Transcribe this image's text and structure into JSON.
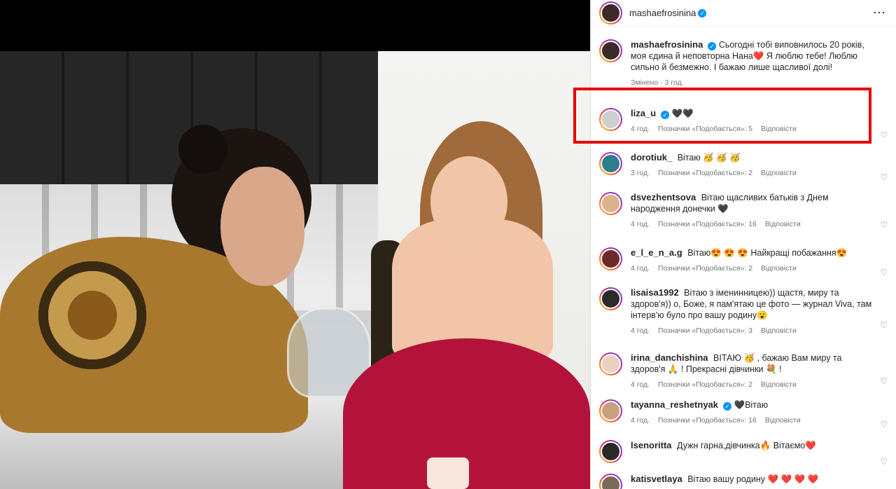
{
  "post": {
    "author": "mashaefrosinina",
    "more_icon": "⋯"
  },
  "caption": {
    "username": "mashaefrosinina",
    "text": "Сьогодні тобі виповнилось 20 років, моя єдина й неповторна Нана❤️  Я люблю тебе! Люблю сильно й безмежно. І бажаю лише щасливої долі!",
    "meta": "Змінено · 3 год."
  },
  "comments": [
    {
      "username": "liza_u",
      "verified": true,
      "text": "🖤🖤",
      "time": "4 год.",
      "likes": "Позначки «Подобається»: 5",
      "reply": "Відповісти"
    },
    {
      "username": "dorotiuk_",
      "verified": false,
      "text": "Вітаю 🥳 🥳 🥳",
      "time": "3 год.",
      "likes": "Позначки «Подобається»: 2",
      "reply": "Відповісти"
    },
    {
      "username": "dsvezhentsova",
      "verified": false,
      "text": "Вітаю щасливих батьків з Днем народження донечки 🖤",
      "time": "4 год.",
      "likes": "Позначки «Подобається»: 16",
      "reply": "Відповісти"
    },
    {
      "username": "e_l_e_n_a.g",
      "verified": false,
      "text": "Вітаю😍 😍 😍 Найкращі побажання😍",
      "time": "4 год.",
      "likes": "Позначки «Подобається»: 2",
      "reply": "Відповісти"
    },
    {
      "username": "lisaisa1992",
      "verified": false,
      "text": "Вітаю з іменинницею)) щастя, миру та здоров'я)) о, Боже, я пам'ятаю це фото — журнал Viva, там інтерв'ю було про вашу родину😮",
      "time": "4 год.",
      "likes": "Позначки «Подобається»: 3",
      "reply": "Відповісти"
    },
    {
      "username": "irina_danchishina",
      "verified": false,
      "text": "ВІТАЮ 🥳 , бажаю Вам миру та здоров'я 🙏 ! Прекрасні дівчинки 💐 !",
      "time": "4 год.",
      "likes": "Позначки «Подобається»: 2",
      "reply": "Відповісти"
    },
    {
      "username": "tayanna_reshetnyak",
      "verified": true,
      "text": "🖤Вітаю",
      "time": "4 год.",
      "likes": "Позначки «Подобається»: 16",
      "reply": "Відповісти"
    },
    {
      "username": "lsenoritta",
      "verified": false,
      "text": "Дужн гарна,дівчинка🔥 Вітаємо❤️",
      "time": "",
      "likes": "",
      "reply": ""
    },
    {
      "username": "katisvetlaya",
      "verified": false,
      "text": "Вітаю вашу родину ❤️ ❤️ ❤️ ❤️",
      "time": "",
      "likes": "",
      "reply": ""
    }
  ],
  "colors": {
    "highlight": "#e60000",
    "verified": "#0095f6"
  }
}
